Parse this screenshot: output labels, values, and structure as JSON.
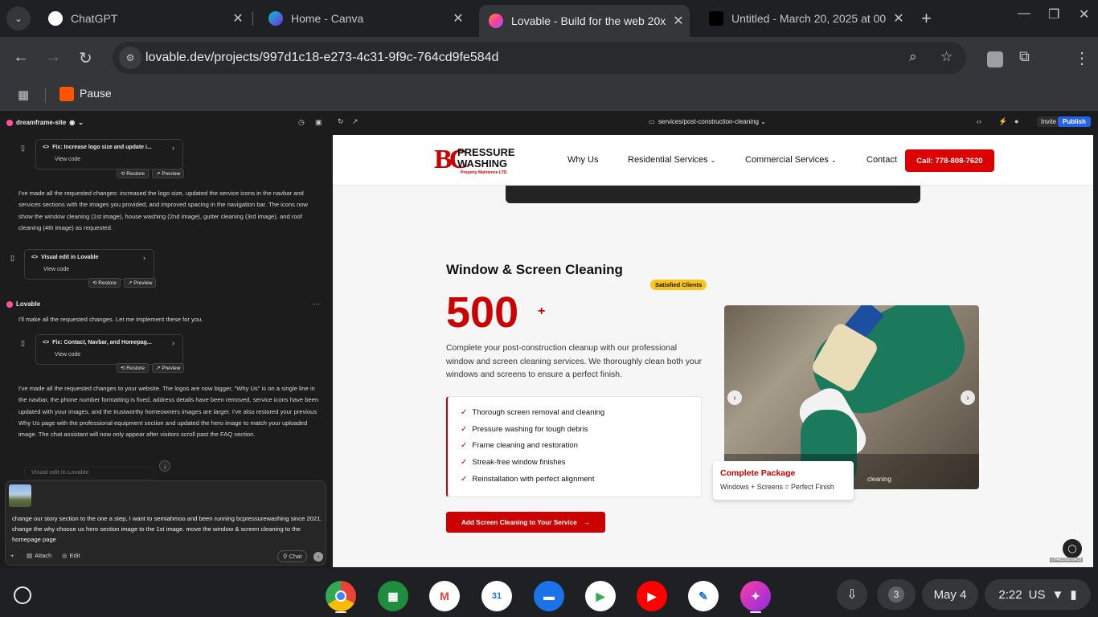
{
  "browser": {
    "tabs": [
      {
        "title": "ChatGPT",
        "icon": "chatgpt-icon"
      },
      {
        "title": "Home - Canva",
        "icon": "canva-icon"
      },
      {
        "title": "Lovable - Build for the web 20x",
        "icon": "lovable-icon"
      },
      {
        "title": "Untitled - March 20, 2025 at 00",
        "icon": "adobe-icon"
      }
    ],
    "url": "lovable.dev/projects/997d1c18-e273-4c31-9f9c-764cd9fe584d",
    "bookmark": "Pause"
  },
  "lovable": {
    "project_name": "dreamframe-site",
    "cards": [
      {
        "title": "Fix: Increase logo size and update i...",
        "view": "View code",
        "restore": "Restore",
        "preview": "Preview"
      },
      {
        "title": "Visual edit in Lovable",
        "view": "View code",
        "restore": "Restore",
        "preview": "Preview"
      },
      {
        "title": "Fix: Contact, Navbar, and Homepag...",
        "view": "View code",
        "restore": "Restore",
        "preview": "Preview"
      },
      {
        "title": "Visual edit in Lovable"
      }
    ],
    "msg1": "I've made all the requested changes: increased the logo size, updated the service icons in the navbar and services sections with the images you provided, and improved spacing in the navigation bar. The icons now show the window cleaning (1st image), house washing (2nd image), gutter cleaning (3rd image), and roof cleaning (4th image) as requested.",
    "assistant_name": "Lovable",
    "msg2": "I'll make all the requested changes. Let me implement these for you.",
    "msg3": "I've made all the requested changes to your website. The logos are now bigger, \"Why Us\" is on a single line in the navbar, the phone number formatting is fixed, address details have been removed, service icons have been updated with your images, and the trustworthy homeowners images are larger. I've also restored your previous Why Us page with the professional equipment section and updated the hero image to match your uploaded image. The chat assistant will now only appear after visitors scroll past the FAQ section.",
    "composer_text": "change our story section to the one a step, I want to semiahmoo and been running bcpressurewashing since 2021. change the why choose us hero section image to the 1st image. move the window & screen cleaning to the homepage page",
    "attach_label": "Attach",
    "edit_label": "Edit",
    "chat_label": "Chat",
    "route": "services/post-construction-cleaning",
    "invite": "Invite",
    "publish": "Publish"
  },
  "site": {
    "logo": {
      "initials": "BC",
      "line1": "PRESSURE",
      "line2": "WASHING",
      "line3": "Property Maintence LTD."
    },
    "nav": [
      "Why Us",
      "Residential Services",
      "Commercial Services",
      "Contact"
    ],
    "call": "Call: 778-808-7620",
    "heading": "Window & Screen Cleaning",
    "badge": "Satisfied Clients",
    "stat": "500",
    "stat_suffix": "+",
    "description": "Complete your post-construction cleanup with our professional window and screen cleaning services. We thoroughly clean both your windows and screens to ensure a perfect finish.",
    "features": [
      "Thorough screen removal and cleaning",
      "Pressure washing for tough debris",
      "Frame cleaning and restoration",
      "Streak-free window finishes",
      "Reinstallation with perfect alignment"
    ],
    "cta": "Add Screen Cleaning to Your Service",
    "caption": "cleaning",
    "package_title": "Complete Package",
    "package_sub": "Windows + Screens = Perfect Finish",
    "version": "v7f4815027d413"
  },
  "shelf": {
    "apps": [
      "Chrome",
      "Slides",
      "Gmail",
      "Calendar",
      "Files",
      "Play Store",
      "YouTube",
      "Docs",
      "Canva"
    ],
    "calendar_num": "31",
    "notif_count": "3",
    "date": "May 4",
    "time": "2:22",
    "locale": "US"
  }
}
